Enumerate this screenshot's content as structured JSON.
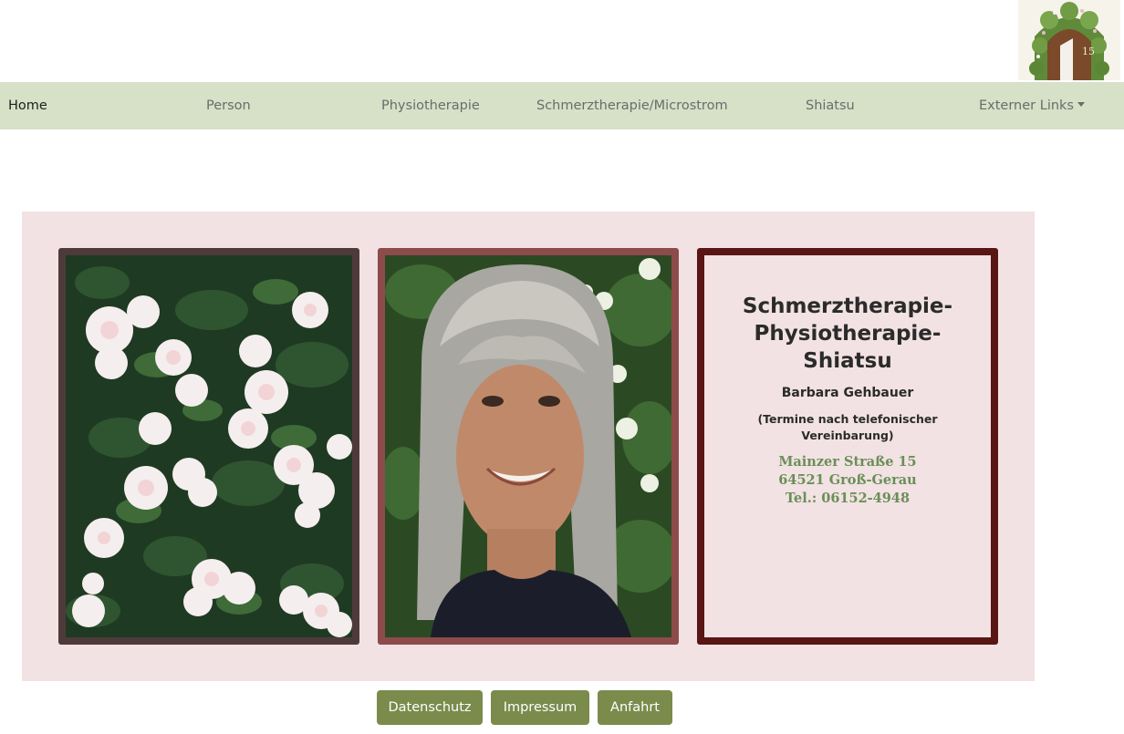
{
  "nav": {
    "items": [
      {
        "label": "Home",
        "active": true
      },
      {
        "label": "Person",
        "active": false
      },
      {
        "label": "Physiotherapie",
        "active": false
      },
      {
        "label": "Schmerztherapie/Microstrom",
        "active": false
      },
      {
        "label": "Shiatsu",
        "active": false
      },
      {
        "label": "Externer Links",
        "active": false,
        "dropdown": true
      }
    ]
  },
  "logo": {
    "number": "15"
  },
  "info": {
    "title_lines": [
      "Schmerztherapie-",
      "Physiotherapie-",
      "Shiatsu"
    ],
    "owner": "Barbara Gehbauer",
    "note": "(Termine nach telefonischer Vereinbarung)",
    "address_lines": [
      "Mainzer Straße 15",
      "64521 Groß-Gerau",
      "Tel.: 06152-4948"
    ]
  },
  "footer": {
    "buttons": [
      "Datenschutz",
      "Impressum",
      "Anfahrt"
    ]
  },
  "colors": {
    "nav_bg": "#d6e1c7",
    "panel_bg": "#f2e2e3",
    "button_bg": "#7a8b4c",
    "address_green": "#6b8f58",
    "frame_dark": "#5a1515"
  }
}
